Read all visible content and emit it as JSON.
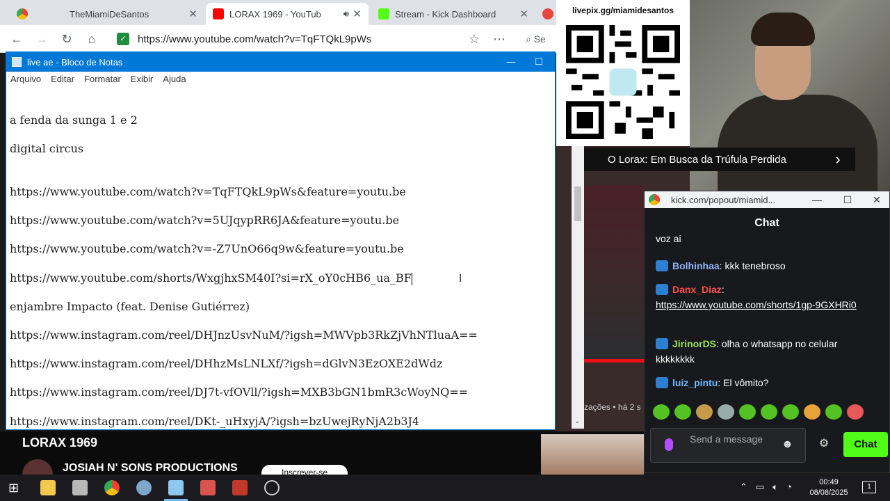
{
  "browser": {
    "tabs": [
      {
        "title": "TheMiamiDeSantos",
        "favicon": "#f5a623"
      },
      {
        "title": "LORAX 1969 - YouTub",
        "favicon": "#ff0000"
      },
      {
        "title": "Stream - Kick Dashboard",
        "favicon": "#53fc18"
      }
    ],
    "url": "https://www.youtube.com/watch?v=TqFTQkL9pWs",
    "search_stub": "Se"
  },
  "notepad": {
    "title": "live ae - Bloco de Notas",
    "menu": [
      "Arquivo",
      "Editar",
      "Formatar",
      "Exibir",
      "Ajuda"
    ],
    "lines": [
      "a fenda da sunga 1 e 2",
      "digital circus",
      "https://www.youtube.com/watch?v=TqFTQkL9pWs&feature=youtu.be",
      "https://www.youtube.com/watch?v=5UJqypRR6JA&feature=youtu.be",
      "https://www.youtube.com/watch?v=-Z7UnO66q9w&feature=youtu.be",
      "https://www.youtube.com/shorts/WxgjhxSM40I?si=rX_oY0cHB6_ua_BF",
      "enjambre Impacto (feat. Denise Gutiérrez)",
      "https://www.instagram.com/reel/DHJnzUsvNuM/?igsh=MWVpb3RkZjVhNTluaA==",
      "https://www.instagram.com/reel/DHhzMsLNLXf/?igsh=dGlvN3EzOXE2dWdz",
      "https://www.instagram.com/reel/DJ7t-vfOVll/?igsh=MXB3bGN1bmR3cWoyNQ==",
      "https://www.instagram.com/reel/DKt-_uHxyjA/?igsh=bzUwejRyNjA2b3J4"
    ]
  },
  "overlay": {
    "livepix": "livepix.gg/miamidesantos",
    "video_title": "O Lorax: Em Busca da Trúfula Perdida",
    "yt_meta": "zações • há 2 s",
    "stream_title": "LORAX 1969",
    "channel": "JOSIAH N' SONS PRODUCTIONS",
    "subscribe": "Inscrever-se"
  },
  "chat": {
    "window_title": "kick.com/popout/miamid...",
    "header": "Chat",
    "partial": "voz ai",
    "messages": [
      {
        "user": "Bolhinhaa",
        "color": "#8ab4f8",
        "text": ": kkk tenebroso"
      },
      {
        "user": "Danx_Diaz",
        "color": "#ff4d4d",
        "text": ":",
        "link": "https://www.youtube.com/shorts/1gp-9GXHRi0"
      },
      {
        "user": "JirinorDS",
        "color": "#9be35d",
        "text": ": olha o whatsapp no celular kkkkkkkk"
      },
      {
        "user": "luiz_pintu",
        "color": "#6fb8ff",
        "text": ": El vômito?"
      }
    ],
    "input_placeholder": "Send a message",
    "send_label": "Chat"
  },
  "taskbar": {
    "time": "00:49",
    "date": "08/08/2025",
    "notifications": "1"
  }
}
